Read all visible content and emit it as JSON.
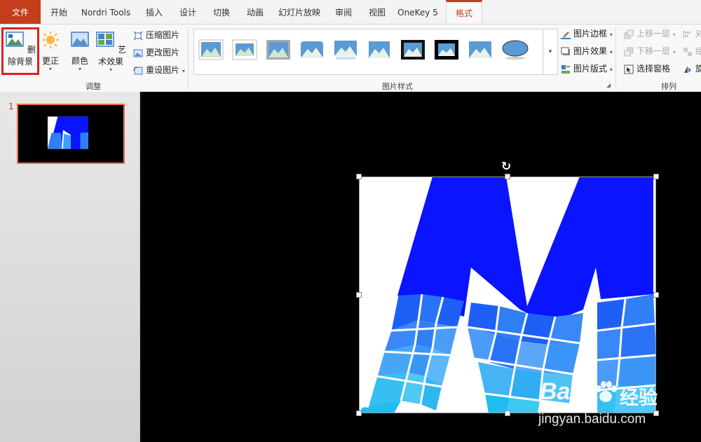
{
  "tabs": [
    "文件",
    "开始",
    "Nordri Tools",
    "插入",
    "设计",
    "切换",
    "动画",
    "幻灯片放映",
    "审阅",
    "视图",
    "OneKey 5",
    "格式"
  ],
  "ribbon": {
    "adjust": {
      "remove_background": "删除背景",
      "corrections": "更正",
      "color": "颜色",
      "artistic_effects": "艺术效果",
      "compress": "压缩图片",
      "change": "更改图片",
      "reset": "重设图片",
      "group_label": "调整"
    },
    "styles": {
      "group_label": "图片样式",
      "border": "图片边框",
      "effects": "图片效果",
      "layout": "图片版式"
    },
    "arrange": {
      "bring_forward": "上移一层",
      "send_backward": "下移一层",
      "selection_pane": "选择窗格",
      "group_label": "排列",
      "align_partial": "对",
      "group_partial": "组",
      "rotate_partial": "旋"
    }
  },
  "slides": {
    "current_number": "1"
  },
  "watermark": {
    "brand": "Bai",
    "brand2": "经验",
    "url": "jingyan.baidu.com"
  },
  "colors": {
    "accent": "#c43e1c",
    "highlight": "#e02020",
    "logo_blue": "#0a14ff"
  }
}
